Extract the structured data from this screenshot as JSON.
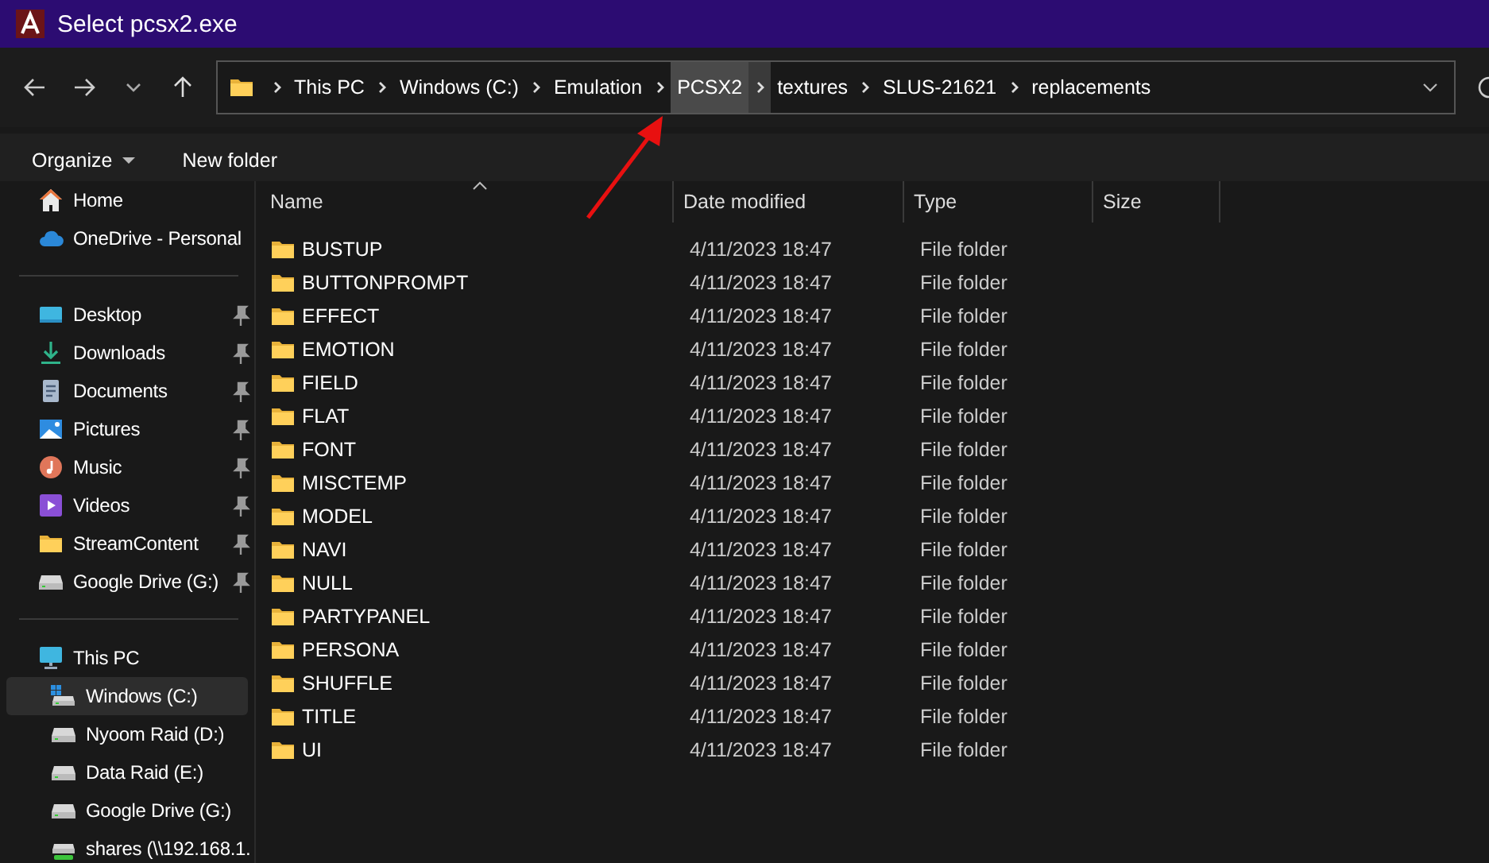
{
  "window": {
    "title": "Select pcsx2.exe"
  },
  "address_bar": {
    "breadcrumbs": [
      {
        "label": "This PC",
        "selected": false
      },
      {
        "label": "Windows (C:)",
        "selected": false
      },
      {
        "label": "Emulation",
        "selected": false
      },
      {
        "label": "PCSX2",
        "selected": true
      },
      {
        "label": "textures",
        "selected": false
      },
      {
        "label": "SLUS-21621",
        "selected": false
      },
      {
        "label": "replacements",
        "selected": false
      }
    ]
  },
  "command_bar": [
    {
      "label": "Organize",
      "kind": "dropdown"
    },
    {
      "label": "New folder",
      "kind": "button"
    }
  ],
  "sidebar": {
    "groups": [
      {
        "items": [
          {
            "label": "Home",
            "kind": "home",
            "pinned": false,
            "selected": false
          },
          {
            "label": "OneDrive - Personal",
            "kind": "cloud",
            "pinned": false,
            "selected": false
          }
        ]
      },
      {
        "items": [
          {
            "label": "Desktop",
            "kind": "desktop",
            "pinned": true,
            "selected": false
          },
          {
            "label": "Downloads",
            "kind": "download",
            "pinned": true,
            "selected": false
          },
          {
            "label": "Documents",
            "kind": "document",
            "pinned": true,
            "selected": false
          },
          {
            "label": "Pictures",
            "kind": "pictures",
            "pinned": true,
            "selected": false
          },
          {
            "label": "Music",
            "kind": "music",
            "pinned": true,
            "selected": false
          },
          {
            "label": "Videos",
            "kind": "video",
            "pinned": true,
            "selected": false
          },
          {
            "label": "StreamContent",
            "kind": "folder",
            "pinned": true,
            "selected": false
          },
          {
            "label": "Google Drive (G:)",
            "kind": "drive",
            "pinned": true,
            "selected": false
          }
        ]
      },
      {
        "items": [
          {
            "label": "This PC",
            "kind": "pc",
            "pinned": false,
            "selected": false,
            "children": [
              {
                "label": "Windows (C:)",
                "kind": "system-drive",
                "pinned": false,
                "selected": true
              },
              {
                "label": "Nyoom Raid (D:)",
                "kind": "drive",
                "pinned": false,
                "selected": false
              },
              {
                "label": "Data Raid (E:)",
                "kind": "drive",
                "pinned": false,
                "selected": false
              },
              {
                "label": "Google Drive (G:)",
                "kind": "drive",
                "pinned": false,
                "selected": false
              },
              {
                "label": "shares (\\\\192.168.1.",
                "kind": "network-drive",
                "pinned": false,
                "selected": false
              }
            ]
          }
        ]
      }
    ]
  },
  "table": {
    "columns": [
      {
        "label": "Name",
        "sorted": true
      },
      {
        "label": "Date modified",
        "sorted": false
      },
      {
        "label": "Type",
        "sorted": false
      },
      {
        "label": "Size",
        "sorted": false
      }
    ],
    "rows": [
      {
        "name": "BUSTUP",
        "date_modified": "4/11/2023 18:47",
        "type": "File folder"
      },
      {
        "name": "BUTTONPROMPT",
        "date_modified": "4/11/2023 18:47",
        "type": "File folder"
      },
      {
        "name": "EFFECT",
        "date_modified": "4/11/2023 18:47",
        "type": "File folder"
      },
      {
        "name": "EMOTION",
        "date_modified": "4/11/2023 18:47",
        "type": "File folder"
      },
      {
        "name": "FIELD",
        "date_modified": "4/11/2023 18:47",
        "type": "File folder"
      },
      {
        "name": "FLAT",
        "date_modified": "4/11/2023 18:47",
        "type": "File folder"
      },
      {
        "name": "FONT",
        "date_modified": "4/11/2023 18:47",
        "type": "File folder"
      },
      {
        "name": "MISCTEMP",
        "date_modified": "4/11/2023 18:47",
        "type": "File folder"
      },
      {
        "name": "MODEL",
        "date_modified": "4/11/2023 18:47",
        "type": "File folder"
      },
      {
        "name": "NAVI",
        "date_modified": "4/11/2023 18:47",
        "type": "File folder"
      },
      {
        "name": "NULL",
        "date_modified": "4/11/2023 18:47",
        "type": "File folder"
      },
      {
        "name": "PARTYPANEL",
        "date_modified": "4/11/2023 18:47",
        "type": "File folder"
      },
      {
        "name": "PERSONA",
        "date_modified": "4/11/2023 18:47",
        "type": "File folder"
      },
      {
        "name": "SHUFFLE",
        "date_modified": "4/11/2023 18:47",
        "type": "File folder"
      },
      {
        "name": "TITLE",
        "date_modified": "4/11/2023 18:47",
        "type": "File folder"
      },
      {
        "name": "UI",
        "date_modified": "4/11/2023 18:47",
        "type": "File folder"
      }
    ]
  }
}
